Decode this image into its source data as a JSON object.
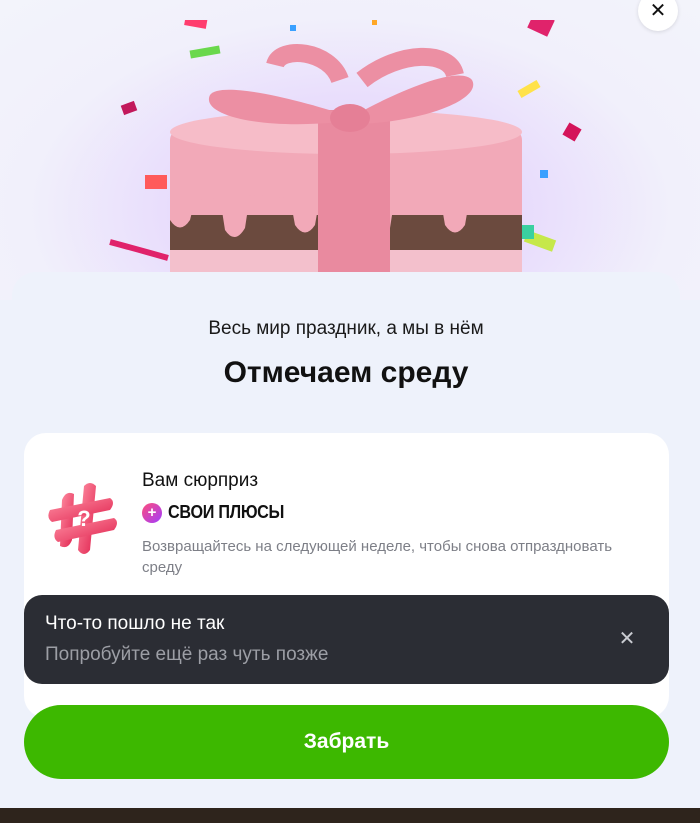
{
  "dialog": {
    "close_glyph": "✕",
    "subtitle": "Весь мир праздник, а мы в нём",
    "title": "Отмечаем среду"
  },
  "card": {
    "heading": "Вам сюрприз",
    "brand_name": "СВОИ ПЛЮСЫ",
    "brand_glyph": "+",
    "description": "Возвращайтесь на следующей неделе, чтобы снова отпраздновать среду",
    "icon": "mystery-gift-icon"
  },
  "toast": {
    "title": "Что-то пошло не так",
    "text": "Попробуйте ещё раз чуть позже",
    "close_glyph": "✕"
  },
  "cta": {
    "label": "Забрать",
    "color": "#3db800"
  },
  "colors": {
    "brand_gradient_start": "#ff4d7a",
    "brand_gradient_end": "#a23cff",
    "toast_bg": "#2b2d34"
  }
}
